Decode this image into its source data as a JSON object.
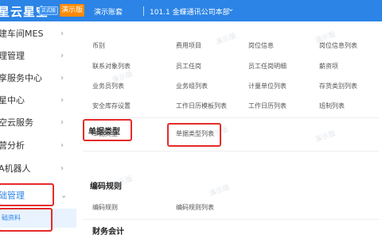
{
  "topbar": {
    "logo": "星云星空",
    "badge": "正式版",
    "demo_button": "演示版",
    "demo_account": "演示账套",
    "company": "101.1 金蝶通讯公司本部",
    "chevron": "⌄"
  },
  "sidebar": {
    "items": [
      {
        "label": "建车间MES"
      },
      {
        "label": "理管理"
      },
      {
        "label": "享服务中心"
      },
      {
        "label": "星中心"
      },
      {
        "label": "空云服务"
      },
      {
        "label": "营分析"
      },
      {
        "label": "A机器人"
      },
      {
        "label": "础管理"
      }
    ],
    "sub_item": "础资料",
    "arrow": "›"
  },
  "main": {
    "rows": [
      [
        "币别",
        "费用项目",
        "岗位信息",
        "岗位信息列表"
      ],
      [
        "联系对象列表",
        "员工任岗",
        "员工任岗明细",
        "薪资项"
      ],
      [
        "业务员列表",
        "业务组列表",
        "计量单位列表",
        "存货类别列表"
      ],
      [
        "安全库存设置",
        "工作日历模板列表",
        "工作日历列表",
        "班制列表"
      ]
    ],
    "sections": {
      "doc_type": {
        "title": "单据类型",
        "items": [
          "单据类型",
          "单据类型列表"
        ]
      },
      "code_rule": {
        "title": "编码规则",
        "items": [
          "编码规则",
          "编码规则列表"
        ]
      },
      "finance": {
        "title": "财务会计"
      }
    },
    "watermark": "演示版"
  }
}
